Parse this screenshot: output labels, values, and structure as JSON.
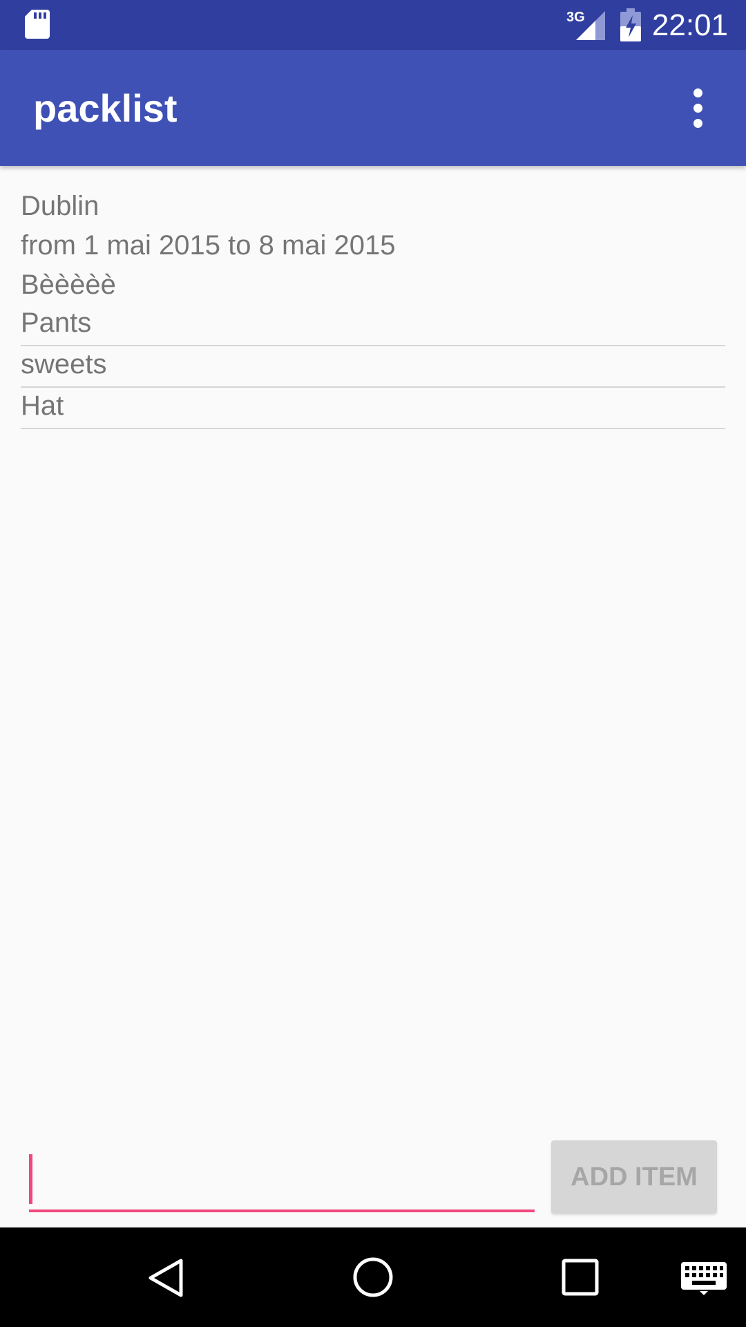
{
  "status_bar": {
    "network": "3G",
    "time": "22:01"
  },
  "app_bar": {
    "title": "packlist",
    "overflow_icon": "more-vert-icon"
  },
  "trip": {
    "name": "Dublin",
    "dates": "from 1 mai 2015 to 8 mai 2015",
    "note": "Bèèèèè"
  },
  "items": [
    {
      "label": "Pants"
    },
    {
      "label": "sweets"
    },
    {
      "label": "Hat"
    }
  ],
  "add_item": {
    "input_value": "",
    "button_label": "ADD ITEM"
  },
  "colors": {
    "status_bar": "#303f9f",
    "app_bar": "#3f51b5",
    "accent": "#f0487c"
  }
}
